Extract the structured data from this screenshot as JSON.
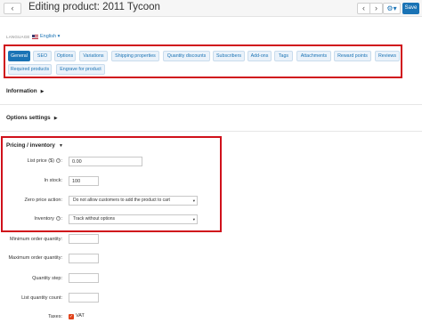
{
  "header": {
    "back_icon": "chevron-left-icon",
    "title": "Editing product: 2011 Tycoon",
    "prev_icon": "chevron-left-icon",
    "next_icon": "chevron-right-icon",
    "settings_icon": "gear-icon",
    "save_label": "Save"
  },
  "language": {
    "label": "LANGUAGE",
    "value": "English"
  },
  "tabs": [
    {
      "label": "General",
      "active": true
    },
    {
      "label": "SEO"
    },
    {
      "label": "Options"
    },
    {
      "label": "Variations"
    },
    {
      "label": "Shipping properties"
    },
    {
      "label": "Quantity discounts"
    },
    {
      "label": "Subscribers"
    },
    {
      "label": "Add-ons"
    },
    {
      "label": "Tags"
    },
    {
      "label": "Attachments"
    },
    {
      "label": "Reward points"
    },
    {
      "label": "Reviews"
    },
    {
      "label": "Required products"
    },
    {
      "label": "Engrave for product"
    }
  ],
  "sections": {
    "information": "Information",
    "options_settings": "Options settings",
    "pricing_inventory": "Pricing / inventory"
  },
  "fields": {
    "list_price_label": "List price ($)",
    "list_price_value": "0.00",
    "in_stock_label": "In stock:",
    "in_stock_value": "100",
    "zero_price_label": "Zero price action:",
    "zero_price_value": "Do not allow customers to add the product to cart",
    "inventory_label": "Inventory",
    "inventory_value": "Track without options",
    "min_qty_label": "Minimum order quantity:",
    "max_qty_label": "Maximum order quantity:",
    "qty_step_label": "Quantity step:",
    "list_qty_count_label": "List quantity count:",
    "taxes_label": "Taxes:",
    "vat_label": "VAT"
  },
  "colors": {
    "accent": "#1a73b5",
    "highlight_frame": "#d0111b",
    "checkbox": "#e0421a"
  }
}
